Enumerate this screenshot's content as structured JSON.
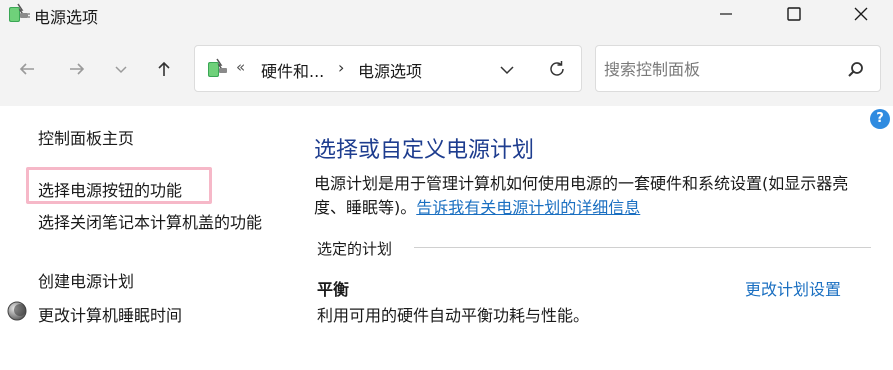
{
  "window": {
    "title": "电源选项",
    "controls": {
      "minimize": "minimize-icon",
      "maximize": "maximize-icon",
      "close": "close-icon"
    }
  },
  "nav": {
    "back": "back-arrow-icon",
    "forward": "forward-arrow-icon",
    "recent": "chevron-down-icon",
    "up": "up-arrow-icon",
    "address": {
      "overflow": "«",
      "crumb1": "硬件和...",
      "separator": "›",
      "crumb2": "电源选项",
      "dropdown": "chevron-down-icon",
      "refresh": "refresh-icon"
    },
    "search": {
      "placeholder": "搜索控制面板",
      "value": ""
    }
  },
  "help": {
    "label": "?"
  },
  "sidebar": {
    "items": [
      {
        "label": "控制面板主页"
      },
      {
        "label": "选择电源按钮的功能"
      },
      {
        "label": "选择关闭笔记本计算机盖的功能"
      },
      {
        "label": "创建电源计划"
      },
      {
        "label": "更改计算机睡眠时间"
      }
    ]
  },
  "main": {
    "title": "选择或自定义电源计划",
    "description": "电源计划是用于管理计算机如何使用电源的一套硬件和系统设置(如显示器亮度、睡眠等)。",
    "description_link": "告诉我有关电源计划的详细信息",
    "section_label": "选定的计划",
    "plan": {
      "name": "平衡",
      "description": "利用可用的硬件自动平衡功耗与性能。",
      "change_link": "更改计划设置"
    }
  },
  "colors": {
    "title_blue": "#1e3d8f",
    "link_blue": "#1a6fc1",
    "highlight_pink": "#f6b8c8",
    "chrome_gray": "#f3f3f3"
  }
}
